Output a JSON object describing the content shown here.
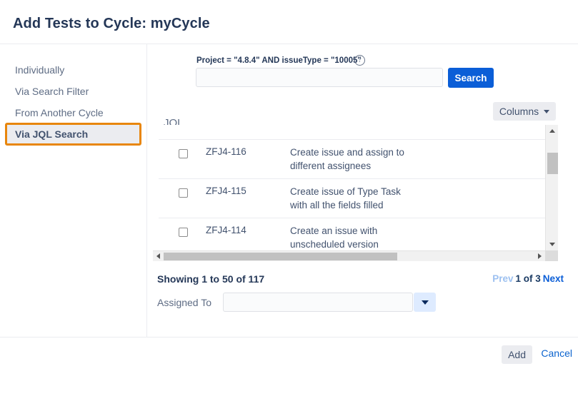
{
  "dialog": {
    "title": "Add Tests to Cycle: myCycle"
  },
  "sidebar": {
    "items": [
      {
        "label": "Individually"
      },
      {
        "label": "Via Search Filter"
      },
      {
        "label": "From Another Cycle"
      },
      {
        "label": "Via JQL Search"
      }
    ],
    "selected": "Via JQL Search",
    "highlight_color": "#E8860C"
  },
  "jql": {
    "hint": "Project = \"4.8.4\" AND issueType = \"10005\"",
    "help_icon": "question-circle-icon",
    "label": "JQL",
    "value": "",
    "placeholder": "",
    "search_label": "Search",
    "search_color": "#0B5ED7"
  },
  "toolbar": {
    "columns_label": "Columns",
    "columns_icon": "chevron-down-icon"
  },
  "table": {
    "rows": [
      {
        "key": "ZFJ4-116",
        "summary": "Create issue and assign to different assignees",
        "checked": false
      },
      {
        "key": "ZFJ4-115",
        "summary": "Create issue of Type Task with all the fields filled",
        "checked": false
      },
      {
        "key": "ZFJ4-114",
        "summary": "Create an issue with unscheduled version",
        "checked": false
      }
    ],
    "vscroll_icon_up": "scroll-up-arrow-icon",
    "vscroll_icon_down": "scroll-down-arrow-icon",
    "hscroll_icon_left": "scroll-left-arrow-icon",
    "hscroll_icon_right": "scroll-right-arrow-icon"
  },
  "results": {
    "showing": "Showing 1 to 50 of 117",
    "prev_label": "Prev",
    "page_label": "1 of 3",
    "next_label": "Next"
  },
  "assigned": {
    "label": "Assigned To",
    "value": "",
    "placeholder": "",
    "dropdown_icon": "chevron-down-icon"
  },
  "footer": {
    "add_label": "Add",
    "cancel_label": "Cancel"
  }
}
